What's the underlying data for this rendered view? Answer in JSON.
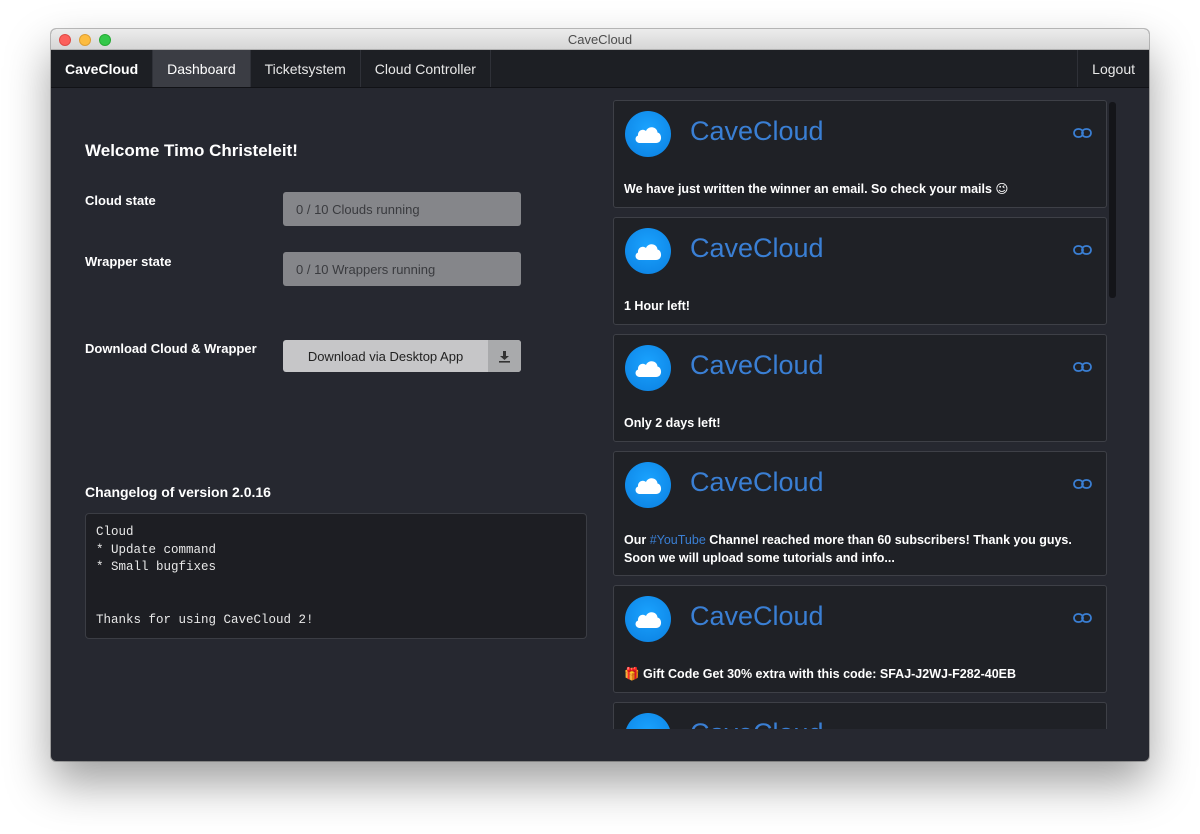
{
  "window": {
    "title": "CaveCloud"
  },
  "nav": {
    "brand": "CaveCloud",
    "items": [
      {
        "label": "Dashboard",
        "active": true
      },
      {
        "label": "Ticketsystem",
        "active": false
      },
      {
        "label": "Cloud Controller",
        "active": false
      }
    ],
    "logout": "Logout"
  },
  "dashboard": {
    "welcome": "Welcome Timo Christeleit!",
    "cloud_state_label": "Cloud state",
    "cloud_state_value": "0 / 10 Clouds running",
    "wrapper_state_label": "Wrapper state",
    "wrapper_state_value": "0 / 10 Wrappers running",
    "download_label": "Download Cloud & Wrapper",
    "download_button": "Download via Desktop App",
    "download_icon": "download-icon"
  },
  "changelog": {
    "title": "Changelog of version 2.0.16",
    "text": "Cloud\n* Update command\n* Small bugfixes\n\n\nThanks for using CaveCloud 2!"
  },
  "feed": {
    "posts": [
      {
        "author": "CaveCloud",
        "text": "We have just written the winner an email. So check your mails 😉",
        "icon": "cloud-icon",
        "link_icon": "link-icon"
      },
      {
        "author": "CaveCloud",
        "text": "1 Hour left!",
        "icon": "cloud-icon",
        "link_icon": "link-icon"
      },
      {
        "author": "CaveCloud",
        "text": "Only 2 days left!",
        "icon": "cloud-icon",
        "link_icon": "link-icon"
      },
      {
        "author": "CaveCloud",
        "text_pre": "Our ",
        "hashtag": "#YouTube",
        "text_post": " Channel reached more than 60 subscribers! Thank you guys. Soon we will upload some tutorials and info...",
        "icon": "cloud-icon",
        "link_icon": "link-icon"
      },
      {
        "author": "CaveCloud",
        "text": "🎁 Gift Code Get 30% extra with this code: SFAJ-J2WJ-F282-40EB",
        "icon": "cloud-icon",
        "link_icon": "link-icon"
      },
      {
        "author": "CaveCloud",
        "text": "",
        "icon": "cloud-icon",
        "link_icon": "link-icon"
      }
    ]
  },
  "colors": {
    "background": "#262830",
    "navbar": "#1d1f24",
    "accent": "#3a7fd4",
    "avatar": "#1aa3ff"
  }
}
